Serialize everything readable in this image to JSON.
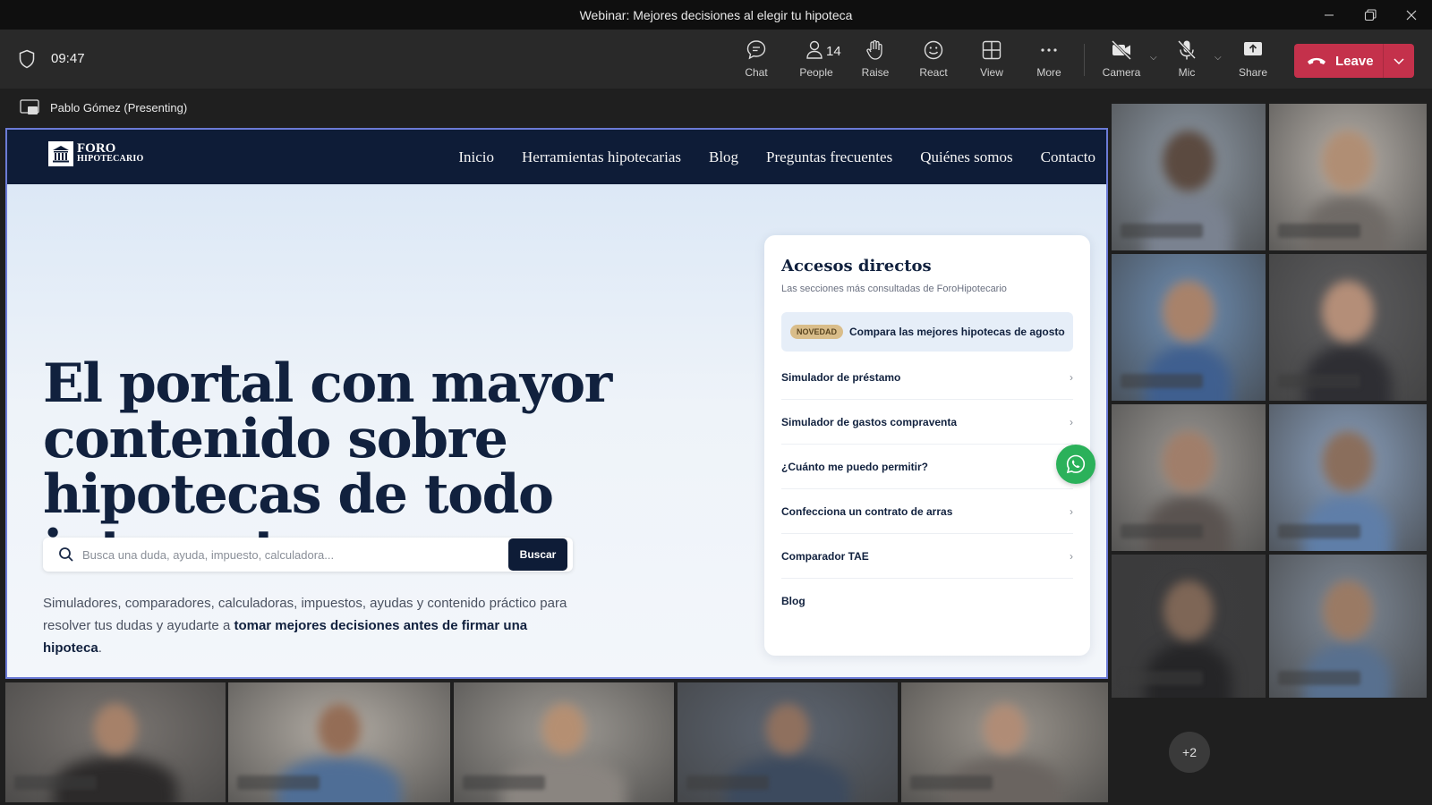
{
  "window": {
    "title": "Webinar: Mejores decisiones al elegir tu hipoteca"
  },
  "toolbar": {
    "time": "09:47",
    "chat_label": "Chat",
    "people_label": "People",
    "people_count": "14",
    "raise_label": "Raise",
    "react_label": "React",
    "view_label": "View",
    "more_label": "More",
    "camera_label": "Camera",
    "mic_label": "Mic",
    "share_label": "Share",
    "leave_label": "Leave"
  },
  "presenter": {
    "label": "Pablo Gómez (Presenting)"
  },
  "site": {
    "logo_line1": "FORO",
    "logo_line2": "HIPOTECARIO",
    "nav": [
      "Inicio",
      "Herramientas hipotecarias",
      "Blog",
      "Preguntas frecuentes",
      "Quiénes somos",
      "Contacto"
    ],
    "hero_title": "El portal con mayor contenido sobre hipotecas de todo internet",
    "search_placeholder": "Busca una duda, ayuda, impuesto, calculadora...",
    "search_button": "Buscar",
    "desc_plain": "Simuladores, comparadores, calculadoras, impuestos, ayudas y contenido práctico para resolver tus dudas y ayudarte a ",
    "desc_bold": "tomar mejores decisiones antes de firmar una hipoteca",
    "desc_end": ".",
    "card": {
      "title": "Accesos directos",
      "subtitle": "Las secciones más consultadas de ForoHipotecario",
      "promo_badge": "NOVEDAD",
      "promo_text": "Compara las mejores hipotecas de agosto",
      "items": [
        "Simulador de préstamo",
        "Simulador de gastos compraventa",
        "¿Cuánto me puedo permitir?",
        "Confecciona un contrato de arras",
        "Comparador TAE",
        "Blog"
      ]
    }
  },
  "gallery": {
    "overflow_count": "+2"
  },
  "colors": {
    "nav_bg": "#0e1c37",
    "leave_red": "#c4314b",
    "presenter_border": "#6b7bd6",
    "whatsapp_green": "#2bb15a",
    "badge_gold": "#d9bd8a"
  }
}
